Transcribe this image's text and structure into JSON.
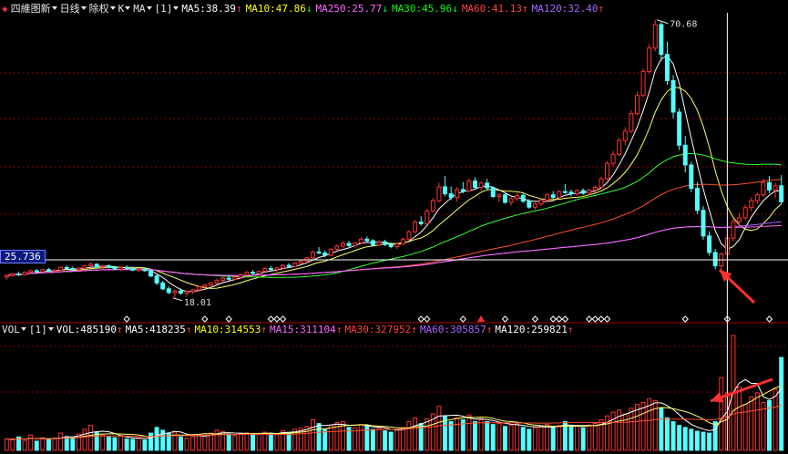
{
  "header": {
    "icon": "diamond-icon",
    "stock_name": "四維图新",
    "period": "日线",
    "adjust": "除权",
    "chart_kind": "K",
    "indicator": "MA",
    "param": "[1]",
    "ma_items": [
      {
        "label": "MA5:38.39",
        "arrow": "↑",
        "color": "#ffffff"
      },
      {
        "label": "MA10:47.86",
        "arrow": "↓",
        "color": "#ffff00"
      },
      {
        "label": "MA250:25.77",
        "arrow": "↓",
        "color": "#ff66ff"
      },
      {
        "label": "MA30:45.96",
        "arrow": "↓",
        "color": "#00ff00"
      },
      {
        "label": "MA60:41.13",
        "arrow": "↑",
        "color": "#ff4040"
      },
      {
        "label": "MA120:32.40",
        "arrow": "↑",
        "color": "#aa66ff"
      }
    ]
  },
  "price_axis_label": "25.736",
  "volume_header": {
    "indicator": "VOL",
    "param": "[1]",
    "items": [
      {
        "label": "VOL:485190",
        "arrow": "↑",
        "color": "#ffffff"
      },
      {
        "label": "MA5:418235",
        "arrow": "↑",
        "color": "#ffffff"
      },
      {
        "label": "MA10:314553",
        "arrow": "↑",
        "color": "#ffff00"
      },
      {
        "label": "MA15:311104",
        "arrow": "↑",
        "color": "#ff66ff"
      },
      {
        "label": "MA30:327952",
        "arrow": "↑",
        "color": "#ff4040"
      },
      {
        "label": "MA60:305857",
        "arrow": "↑",
        "color": "#aa66ff"
      },
      {
        "label": "MA120:259821",
        "arrow": "↑",
        "color": "#ffffff"
      }
    ]
  },
  "colors": {
    "up": "#ff3232",
    "down": "#54ffff",
    "grid": "#8b0000",
    "crosshair": "#ffffff",
    "annotation_arrow": "#ff3030"
  },
  "chart_data": {
    "type": "candlestick",
    "price_range": [
      16,
      72
    ],
    "high_annotation": "70.68",
    "low_annotation": "18.01",
    "crosshair_price": 25.736,
    "candles_ohlc": [
      [
        22.5,
        23.0,
        22.0,
        22.8
      ],
      [
        22.8,
        23.3,
        22.6,
        23.1
      ],
      [
        23.1,
        23.5,
        22.7,
        22.9
      ],
      [
        22.9,
        23.6,
        22.8,
        23.4
      ],
      [
        23.4,
        23.9,
        23.1,
        23.7
      ],
      [
        23.7,
        24.0,
        23.3,
        23.5
      ],
      [
        23.5,
        24.1,
        23.4,
        23.9
      ],
      [
        23.9,
        24.2,
        23.5,
        23.6
      ],
      [
        23.6,
        24.0,
        23.3,
        23.8
      ],
      [
        23.8,
        24.5,
        23.7,
        24.3
      ],
      [
        24.3,
        24.7,
        23.9,
        24.1
      ],
      [
        24.1,
        24.5,
        23.7,
        23.9
      ],
      [
        23.9,
        24.3,
        23.6,
        24.2
      ],
      [
        24.2,
        24.8,
        24.0,
        24.6
      ],
      [
        24.6,
        25.3,
        24.4,
        24.9
      ],
      [
        24.9,
        25.1,
        24.2,
        24.4
      ],
      [
        24.4,
        24.8,
        24.0,
        24.6
      ],
      [
        24.6,
        24.9,
        24.1,
        24.3
      ],
      [
        24.3,
        24.6,
        23.8,
        24.0
      ],
      [
        24.0,
        24.5,
        23.7,
        24.3
      ],
      [
        24.3,
        24.7,
        23.9,
        24.1
      ],
      [
        24.1,
        24.4,
        23.6,
        23.8
      ],
      [
        23.8,
        24.2,
        23.4,
        24.0
      ],
      [
        24.0,
        24.3,
        23.5,
        23.7
      ],
      [
        23.7,
        23.9,
        22.5,
        22.7
      ],
      [
        22.7,
        23.0,
        21.0,
        21.4
      ],
      [
        21.4,
        21.8,
        20.0,
        20.3
      ],
      [
        20.3,
        20.8,
        19.3,
        19.6
      ],
      [
        19.6,
        20.2,
        18.6,
        19.9
      ],
      [
        19.9,
        20.4,
        19.2,
        19.5
      ],
      [
        19.5,
        20.0,
        18.8,
        19.8
      ],
      [
        19.8,
        20.3,
        19.3,
        20.1
      ],
      [
        20.1,
        20.9,
        19.8,
        20.7
      ],
      [
        20.7,
        21.3,
        20.4,
        21.0
      ],
      [
        21.0,
        21.6,
        20.6,
        21.4
      ],
      [
        21.4,
        22.2,
        21.1,
        21.9
      ],
      [
        21.9,
        22.6,
        21.6,
        22.3
      ],
      [
        22.3,
        22.8,
        21.8,
        22.1
      ],
      [
        22.1,
        22.7,
        21.9,
        22.5
      ],
      [
        22.5,
        23.2,
        22.2,
        22.9
      ],
      [
        22.9,
        23.6,
        22.6,
        23.4
      ],
      [
        23.4,
        23.8,
        22.9,
        23.2
      ],
      [
        23.2,
        23.7,
        22.8,
        23.6
      ],
      [
        23.6,
        24.3,
        23.4,
        24.1
      ],
      [
        24.1,
        24.6,
        23.7,
        23.9
      ],
      [
        23.9,
        24.4,
        23.5,
        24.2
      ],
      [
        24.2,
        24.9,
        24.0,
        24.7
      ],
      [
        24.7,
        25.1,
        24.2,
        24.5
      ],
      [
        24.5,
        25.3,
        24.3,
        25.1
      ],
      [
        25.1,
        25.8,
        24.9,
        25.5
      ],
      [
        25.5,
        26.3,
        25.2,
        26.1
      ],
      [
        26.1,
        27.4,
        25.9,
        27.2
      ],
      [
        27.2,
        28.1,
        26.8,
        27.0
      ],
      [
        27.0,
        27.5,
        26.2,
        26.6
      ],
      [
        26.6,
        27.9,
        26.4,
        27.7
      ],
      [
        27.7,
        28.6,
        27.4,
        28.3
      ],
      [
        28.3,
        29.2,
        28.0,
        28.8
      ],
      [
        28.8,
        29.3,
        28.1,
        28.4
      ],
      [
        28.4,
        29.0,
        28.0,
        28.9
      ],
      [
        28.9,
        29.9,
        28.7,
        29.6
      ],
      [
        29.6,
        30.1,
        29.0,
        29.3
      ],
      [
        29.3,
        29.6,
        28.2,
        28.5
      ],
      [
        28.5,
        29.4,
        28.3,
        29.1
      ],
      [
        29.1,
        29.5,
        28.3,
        28.6
      ],
      [
        28.6,
        29.0,
        27.9,
        28.2
      ],
      [
        28.2,
        28.9,
        27.8,
        28.7
      ],
      [
        28.7,
        29.9,
        28.5,
        29.6
      ],
      [
        29.6,
        31.3,
        29.4,
        31.0
      ],
      [
        31.0,
        33.2,
        30.7,
        32.8
      ],
      [
        32.8,
        33.9,
        32.1,
        32.5
      ],
      [
        32.5,
        35.2,
        32.3,
        34.9
      ],
      [
        34.9,
        37.3,
        34.6,
        36.8
      ],
      [
        36.8,
        40.2,
        36.5,
        39.4
      ],
      [
        39.4,
        41.4,
        37.6,
        38.1
      ],
      [
        38.1,
        39.5,
        36.9,
        37.4
      ],
      [
        37.4,
        39.4,
        36.6,
        38.9
      ],
      [
        38.9,
        40.3,
        38.2,
        38.6
      ],
      [
        38.6,
        40.9,
        38.4,
        40.5
      ],
      [
        40.5,
        41.2,
        39.0,
        39.3
      ],
      [
        39.3,
        40.4,
        38.7,
        40.1
      ],
      [
        40.1,
        40.9,
        38.8,
        39.2
      ],
      [
        39.2,
        39.5,
        37.3,
        37.6
      ],
      [
        37.6,
        38.2,
        36.6,
        37.9
      ],
      [
        37.9,
        38.4,
        36.2,
        36.5
      ],
      [
        36.5,
        37.5,
        35.9,
        37.2
      ],
      [
        37.2,
        38.2,
        36.8,
        37.8
      ],
      [
        37.8,
        38.3,
        36.4,
        36.7
      ],
      [
        36.7,
        37.1,
        35.3,
        35.6
      ],
      [
        35.6,
        36.5,
        35.1,
        36.2
      ],
      [
        36.2,
        37.1,
        35.8,
        36.9
      ],
      [
        36.9,
        38.2,
        36.5,
        37.9
      ],
      [
        37.9,
        38.6,
        37.2,
        37.4
      ],
      [
        37.4,
        38.8,
        37.2,
        38.5
      ],
      [
        38.5,
        39.9,
        38.1,
        38.4
      ],
      [
        38.4,
        38.9,
        37.6,
        38.1
      ],
      [
        38.1,
        38.9,
        37.7,
        38.7
      ],
      [
        38.7,
        39.1,
        37.9,
        38.2
      ],
      [
        38.2,
        39.0,
        37.8,
        38.8
      ],
      [
        38.8,
        39.7,
        38.4,
        39.3
      ],
      [
        39.3,
        41.3,
        39.0,
        40.9
      ],
      [
        40.9,
        44.2,
        40.6,
        43.8
      ],
      [
        43.8,
        46.2,
        43.1,
        45.5
      ],
      [
        45.5,
        48.6,
        45.2,
        48.1
      ],
      [
        48.1,
        50.6,
        47.2,
        49.8
      ],
      [
        49.8,
        53.7,
        49.4,
        53.1
      ],
      [
        53.1,
        57.2,
        52.8,
        56.5
      ],
      [
        56.5,
        61.6,
        56.2,
        61.0
      ],
      [
        61.0,
        66.2,
        60.6,
        65.4
      ],
      [
        65.4,
        70.68,
        64.8,
        69.8
      ],
      [
        69.8,
        70.4,
        63.0,
        64.2
      ],
      [
        64.2,
        66.6,
        58.5,
        59.3
      ],
      [
        59.3,
        60.3,
        52.2,
        53.4
      ],
      [
        53.4,
        54.1,
        46.3,
        47.2
      ],
      [
        47.2,
        48.9,
        42.1,
        43.5
      ],
      [
        43.5,
        44.1,
        38.4,
        39.1
      ],
      [
        39.1,
        40.3,
        34.3,
        35.0
      ],
      [
        35.0,
        35.8,
        29.5,
        30.2
      ],
      [
        30.2,
        31.1,
        26.5,
        27.1
      ],
      [
        27.1,
        27.8,
        24.0,
        24.6
      ],
      [
        24.6,
        27.1,
        23.7,
        26.8
      ],
      [
        26.8,
        30.3,
        26.3,
        29.8
      ],
      [
        29.8,
        33.5,
        29.2,
        32.9
      ],
      [
        32.9,
        34.5,
        31.8,
        33.6
      ],
      [
        33.6,
        36.1,
        33.2,
        35.5
      ],
      [
        35.5,
        37.4,
        34.9,
        36.8
      ],
      [
        36.8,
        38.3,
        36.2,
        37.9
      ],
      [
        37.9,
        40.9,
        37.5,
        40.2
      ],
      [
        40.2,
        41.4,
        38.2,
        38.8
      ],
      [
        38.8,
        40.2,
        37.4,
        39.6
      ],
      [
        39.6,
        41.6,
        36.1,
        36.6
      ]
    ],
    "volume_range": [
      0,
      600000
    ],
    "volumes": [
      60000,
      55000,
      70000,
      52000,
      80000,
      48000,
      65000,
      58000,
      62000,
      90000,
      72000,
      68000,
      85000,
      110000,
      130000,
      95000,
      80000,
      70000,
      66000,
      75000,
      60000,
      58000,
      62000,
      54000,
      90000,
      120000,
      105000,
      88000,
      95000,
      70000,
      64000,
      72000,
      80000,
      86000,
      90000,
      105000,
      98000,
      84000,
      76000,
      88000,
      92000,
      80000,
      86000,
      95000,
      90000,
      88000,
      102000,
      94000,
      110000,
      115000,
      125000,
      160000,
      140000,
      110000,
      130000,
      145000,
      150000,
      120000,
      118000,
      135000,
      128000,
      110000,
      116000,
      102000,
      95000,
      108000,
      120000,
      150000,
      170000,
      140000,
      165000,
      190000,
      230000,
      180000,
      150000,
      170000,
      160000,
      185000,
      150000,
      160000,
      150000,
      135000,
      140000,
      125000,
      130000,
      138000,
      120000,
      110000,
      118000,
      126000,
      135000,
      120000,
      130000,
      150000,
      122000,
      128000,
      118000,
      132000,
      140000,
      160000,
      180000,
      200000,
      210000,
      190000,
      220000,
      240000,
      250000,
      270000,
      260000,
      220000,
      170000,
      150000,
      130000,
      120000,
      110000,
      100000,
      95000,
      90000,
      150000,
      380000,
      300000,
      600000,
      330000,
      240000,
      280000,
      300000,
      250000,
      260000,
      320000,
      485190
    ],
    "markers": {
      "white_diamond_bars": [
        20,
        33,
        37,
        44,
        45,
        46,
        69,
        70,
        76,
        83,
        88,
        91,
        92,
        93,
        97,
        98,
        99,
        100,
        113,
        120,
        127
      ],
      "red_triangle_bars": [
        79
      ]
    }
  }
}
